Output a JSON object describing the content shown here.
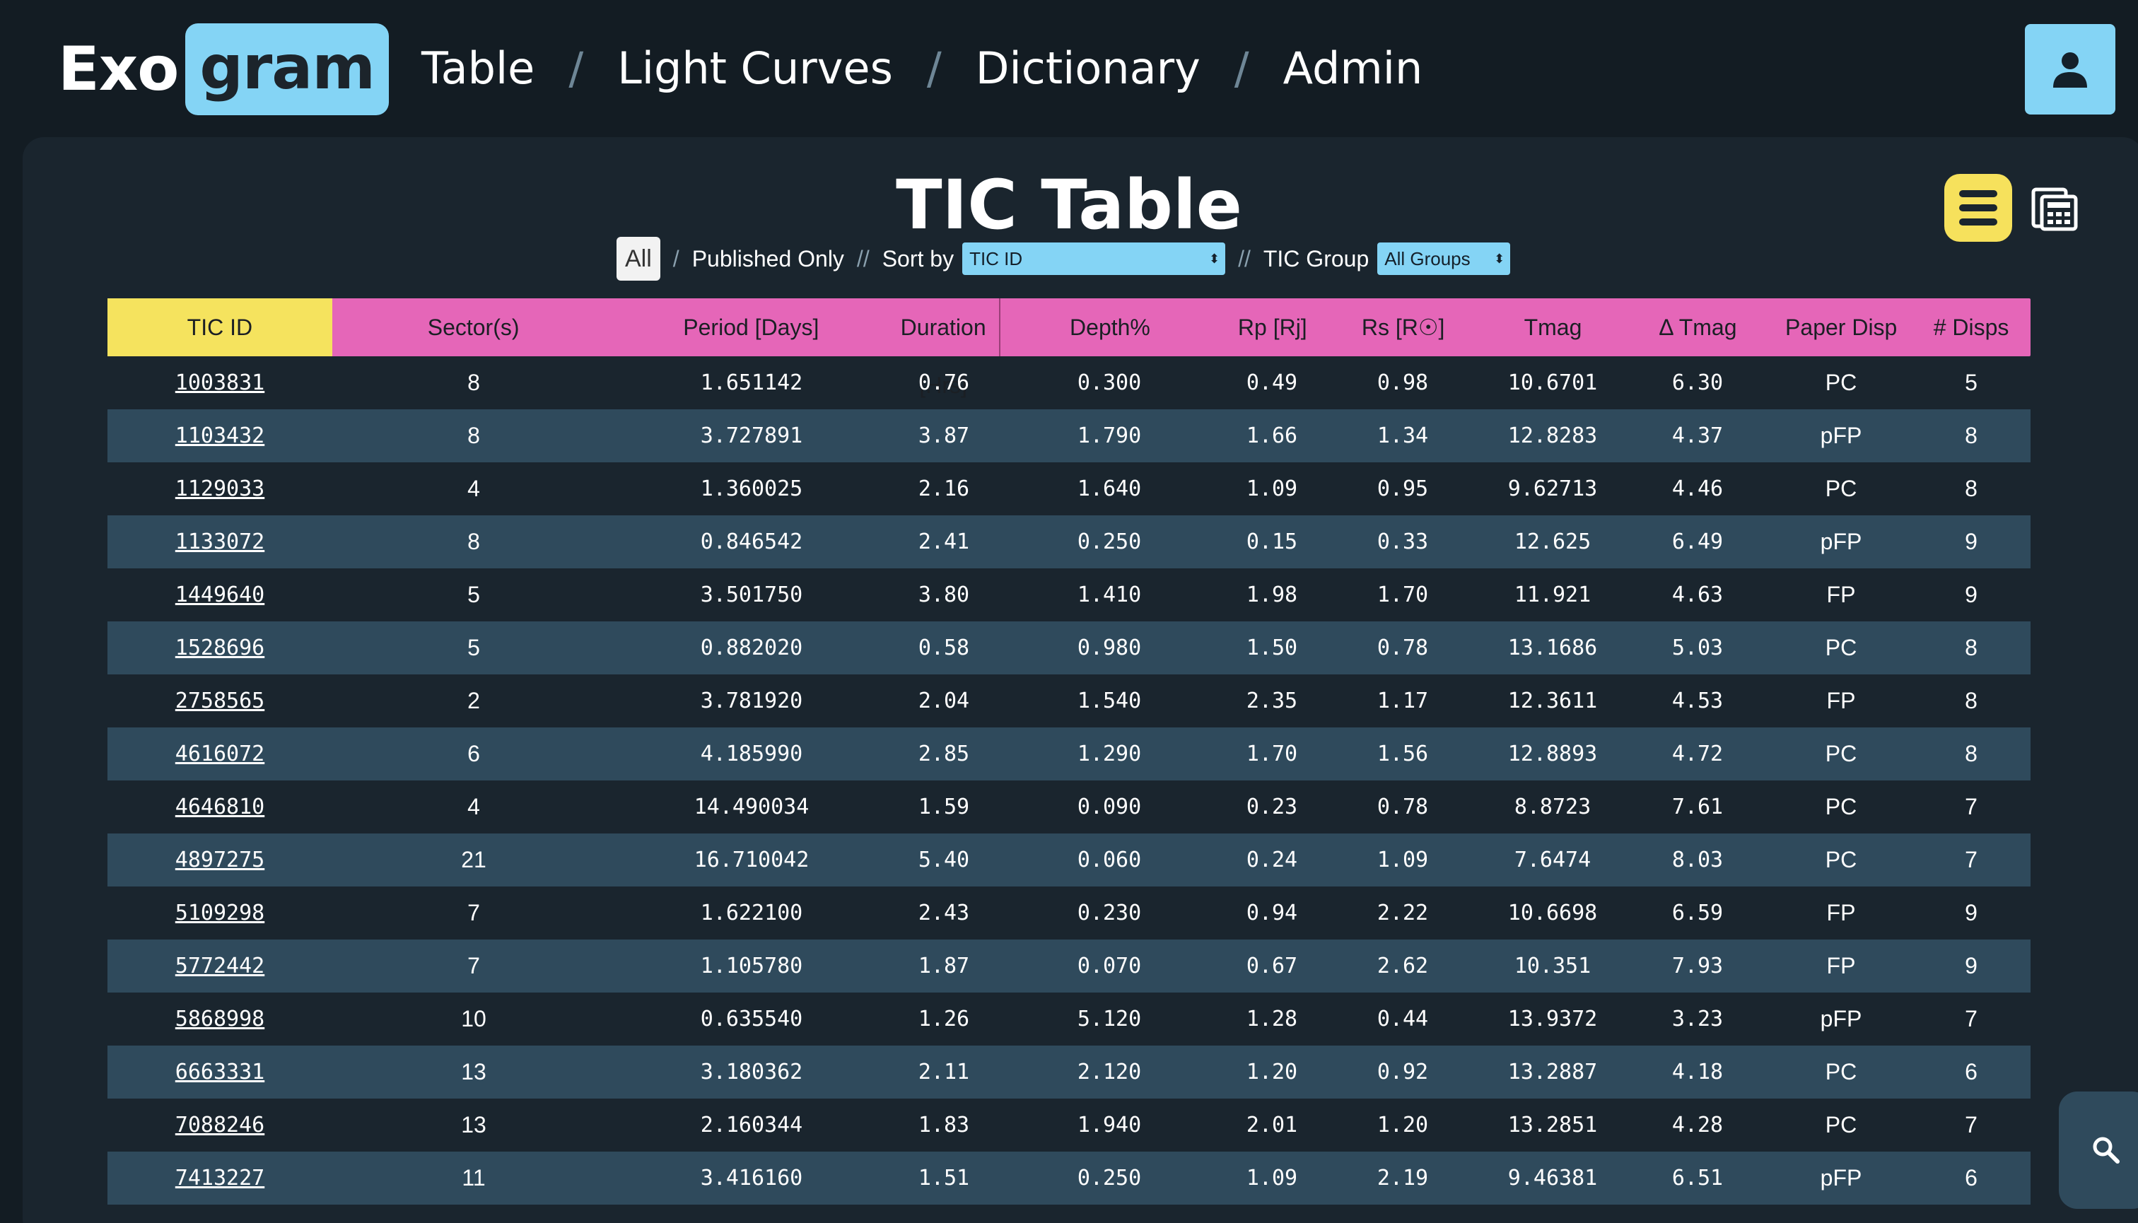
{
  "app": {
    "logo_left": "Exo",
    "logo_right": "gram"
  },
  "nav": {
    "items": [
      "Table",
      "Light Curves",
      "Dictionary",
      "Admin"
    ],
    "separator": "/"
  },
  "icons": {
    "user": "user-icon",
    "menu": "menu-icon",
    "calculator": "calculator-icon",
    "search": "search-icon"
  },
  "colors": {
    "accent_blue": "#84d4f5",
    "accent_yellow": "#f5e35e",
    "accent_pink": "#e566b8",
    "row_alt": "#2f4a5c",
    "background": "#131c23"
  },
  "page": {
    "title": "TIC Table"
  },
  "filters": {
    "all_label": "All",
    "published_label": "Published Only",
    "sort_label": "Sort by",
    "sort_value": "TIC ID",
    "group_label": "TIC Group",
    "group_value": "All Groups",
    "sep_single": "/",
    "sep_double": "//"
  },
  "table": {
    "headers": [
      "TIC ID",
      "Sector(s)",
      "Period [Days]",
      "Duration [Hrs]",
      "Depth%",
      "Rp [Rj]",
      "Rs [R☉]",
      "Tmag",
      "Δ Tmag",
      "Paper Disp",
      "# Disps"
    ],
    "rows": [
      [
        "1003831",
        "8",
        "1.651142",
        "0.76",
        "0.300",
        "0.49",
        "0.98",
        "10.6701",
        "6.30",
        "PC",
        "5"
      ],
      [
        "1103432",
        "8",
        "3.727891",
        "3.87",
        "1.790",
        "1.66",
        "1.34",
        "12.8283",
        "4.37",
        "pFP",
        "8"
      ],
      [
        "1129033",
        "4",
        "1.360025",
        "2.16",
        "1.640",
        "1.09",
        "0.95",
        "9.62713",
        "4.46",
        "PC",
        "8"
      ],
      [
        "1133072",
        "8",
        "0.846542",
        "2.41",
        "0.250",
        "0.15",
        "0.33",
        "12.625",
        "6.49",
        "pFP",
        "9"
      ],
      [
        "1449640",
        "5",
        "3.501750",
        "3.80",
        "1.410",
        "1.98",
        "1.70",
        "11.921",
        "4.63",
        "FP",
        "9"
      ],
      [
        "1528696",
        "5",
        "0.882020",
        "0.58",
        "0.980",
        "1.50",
        "0.78",
        "13.1686",
        "5.03",
        "PC",
        "8"
      ],
      [
        "2758565",
        "2",
        "3.781920",
        "2.04",
        "1.540",
        "2.35",
        "1.17",
        "12.3611",
        "4.53",
        "FP",
        "8"
      ],
      [
        "4616072",
        "6",
        "4.185990",
        "2.85",
        "1.290",
        "1.70",
        "1.56",
        "12.8893",
        "4.72",
        "PC",
        "8"
      ],
      [
        "4646810",
        "4",
        "14.490034",
        "1.59",
        "0.090",
        "0.23",
        "0.78",
        "8.8723",
        "7.61",
        "PC",
        "7"
      ],
      [
        "4897275",
        "21",
        "16.710042",
        "5.40",
        "0.060",
        "0.24",
        "1.09",
        "7.6474",
        "8.03",
        "PC",
        "7"
      ],
      [
        "5109298",
        "7",
        "1.622100",
        "2.43",
        "0.230",
        "0.94",
        "2.22",
        "10.6698",
        "6.59",
        "FP",
        "9"
      ],
      [
        "5772442",
        "7",
        "1.105780",
        "1.87",
        "0.070",
        "0.67",
        "2.62",
        "10.351",
        "7.93",
        "FP",
        "9"
      ],
      [
        "5868998",
        "10",
        "0.635540",
        "1.26",
        "5.120",
        "1.28",
        "0.44",
        "13.9372",
        "3.23",
        "pFP",
        "7"
      ],
      [
        "6663331",
        "13",
        "3.180362",
        "2.11",
        "2.120",
        "1.20",
        "0.92",
        "13.2887",
        "4.18",
        "PC",
        "6"
      ],
      [
        "7088246",
        "13",
        "2.160344",
        "1.83",
        "1.940",
        "2.01",
        "1.20",
        "13.2851",
        "4.28",
        "PC",
        "7"
      ],
      [
        "7413227",
        "11",
        "3.416160",
        "1.51",
        "0.250",
        "1.09",
        "2.19",
        "9.46381",
        "6.51",
        "pFP",
        "6"
      ]
    ]
  }
}
